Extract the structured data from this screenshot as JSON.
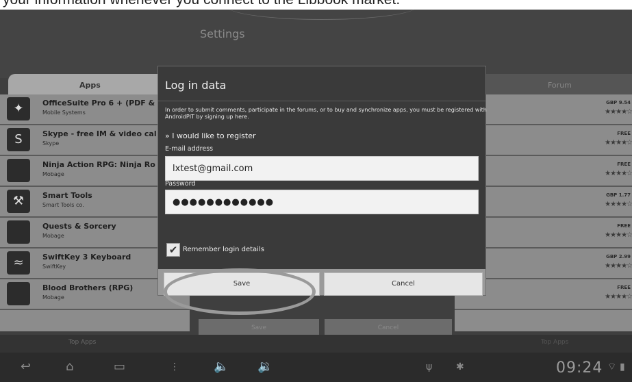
{
  "page_caption": "your information whenever you connect to the Libbook market.",
  "header": {
    "title": "Settings"
  },
  "tabs": {
    "apps": "Apps",
    "forum": "Forum"
  },
  "apps": [
    {
      "name": "OfficeSuite Pro 6 + (PDF &",
      "developer": "Mobile Systems",
      "price": "GBP 9.54",
      "icon": "officesuite-icon"
    },
    {
      "name": "Skype - free IM & video cal",
      "developer": "Skype",
      "price": "FREE",
      "icon": "skype-icon"
    },
    {
      "name": "Ninja Action RPG: Ninja Ro",
      "developer": "Mobage",
      "price": "FREE",
      "icon": "ninja-icon"
    },
    {
      "name": "Smart Tools",
      "developer": "Smart Tools co.",
      "price": "GBP 1.77",
      "icon": "tools-icon"
    },
    {
      "name": "Quests & Sorcery",
      "developer": "Mobage",
      "price": "FREE",
      "icon": "quest-icon"
    },
    {
      "name": "SwiftKey 3 Keyboard",
      "developer": "SwiftKey",
      "price": "GBP 2.99",
      "icon": "swiftkey-icon"
    },
    {
      "name": "Blood Brothers (RPG)",
      "developer": "Mobage",
      "price": "FREE",
      "icon": "blood-brothers-icon"
    }
  ],
  "background_buttons": {
    "save": "Save",
    "cancel": "Cancel"
  },
  "footer": {
    "left": "Top Apps",
    "right": "Top Apps"
  },
  "dialog": {
    "title": "Log in data",
    "description": "In order to submit comments, participate in the forums, or to buy and synchronize apps, you must be registered with AndroidPIT by signing up here.",
    "register_link": "» I would like to register",
    "email_label": "E-mail address",
    "email_value": "lxtest@gmail.com",
    "password_label": "Password",
    "password_value": "●●●●●●●●●●●●",
    "remember_label": "Remember login details",
    "remember_checked": true,
    "save_label": "Save",
    "cancel_label": "Cancel"
  },
  "status_bar": {
    "time": "09:24"
  },
  "colors": {
    "dialog_bg": "#3a3a3a",
    "button_bar": "#9a9a9a",
    "highlight": "#9a9a9a"
  }
}
